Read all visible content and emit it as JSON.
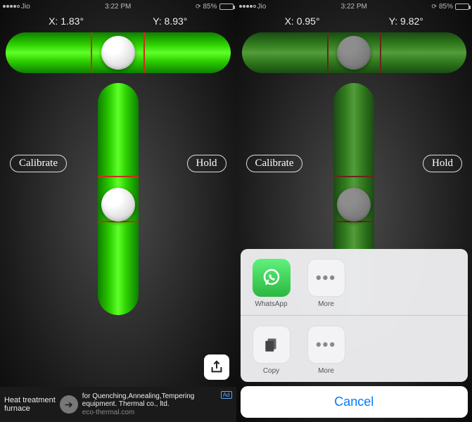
{
  "left": {
    "status": {
      "carrier": "Jio",
      "time": "3:22 PM",
      "battery": "85%"
    },
    "readings": {
      "x_label": "X: 1.83°",
      "y_label": "Y: 8.93°"
    },
    "buttons": {
      "calibrate": "Calibrate",
      "hold": "Hold"
    },
    "ad": {
      "title1": "Heat treatment",
      "title2": "furnace",
      "desc1": "for Quenching,Annealing,Tempering",
      "desc2": "equipment. Thermal co., ltd.",
      "url": "eco-thermal.com",
      "badge": "Ad"
    }
  },
  "right": {
    "status": {
      "carrier": "Jio",
      "time": "3:22 PM",
      "battery": "85%"
    },
    "readings": {
      "x_label": "X: 0.95°",
      "y_label": "Y: 9.82°"
    },
    "buttons": {
      "calibrate": "Calibrate",
      "hold": "Hold"
    },
    "share_sheet": {
      "row1": [
        {
          "name": "WhatsApp"
        },
        {
          "name": "More"
        }
      ],
      "row2": [
        {
          "name": "Copy"
        },
        {
          "name": "More"
        }
      ],
      "cancel": "Cancel"
    }
  }
}
